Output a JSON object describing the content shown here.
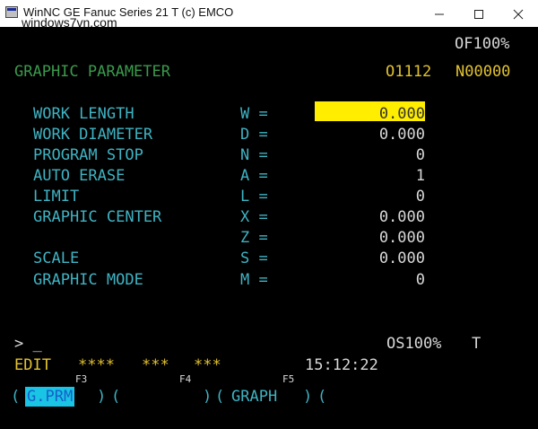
{
  "window": {
    "title": "WinNC GE Fanuc Series 21 T (c) EMCO",
    "watermark": "windows7vn.com"
  },
  "header": {
    "override": "OF100%",
    "screen_title": "GRAPHIC PARAMETER",
    "program": "O1112",
    "block": "N00000"
  },
  "params": [
    {
      "label": "WORK LENGTH",
      "letter": "W =",
      "value": "0.000",
      "selected": true
    },
    {
      "label": "WORK DIAMETER",
      "letter": "D =",
      "value": "0.000"
    },
    {
      "label": "PROGRAM STOP",
      "letter": "N =",
      "value": "0"
    },
    {
      "label": "AUTO ERASE",
      "letter": "A =",
      "value": "1"
    },
    {
      "label": "LIMIT",
      "letter": "L =",
      "value": "0"
    },
    {
      "label": "GRAPHIC CENTER",
      "letter": "X =",
      "value": "0.000"
    },
    {
      "label": "",
      "letter": "Z =",
      "value": "0.000"
    },
    {
      "label": "SCALE",
      "letter": "S =",
      "value": "0.000"
    },
    {
      "label": "GRAPHIC MODE",
      "letter": "M =",
      "value": "0"
    }
  ],
  "input": {
    "prompt": "> _"
  },
  "status": {
    "spindle_override": "OS100%",
    "channel": "T",
    "mode": "EDIT",
    "stars1": "****",
    "stars2": "***",
    "stars3": "***",
    "time": "15:12:22"
  },
  "softkeys": {
    "f3": "F3",
    "f4": "F4",
    "f5": "F5",
    "open1": "(",
    "gprm": "G.PRM",
    "close1": ")",
    "open2": "(",
    "close2": ")",
    "open3": "(",
    "graph": "GRAPH",
    "close3": ")",
    "open4": "("
  },
  "colors": {
    "background": "#000000",
    "text_cyan": "#3fb3c3",
    "title_green": "#3a9a4c",
    "accent_yellow": "#e2c230",
    "field_highlight": "#ffee00",
    "softkey_highlight": "#19c4e5"
  }
}
